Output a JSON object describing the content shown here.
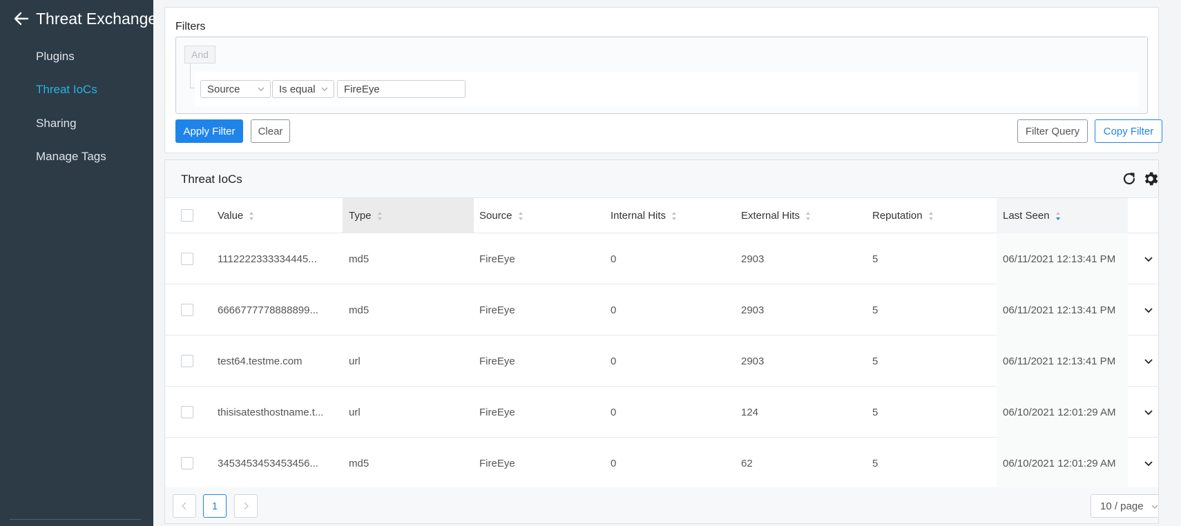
{
  "sidebar": {
    "title": "Threat Exchange",
    "items": [
      {
        "label": "Plugins",
        "active": false
      },
      {
        "label": "Threat IoCs",
        "active": true
      },
      {
        "label": "Sharing",
        "active": false
      },
      {
        "label": "Manage Tags",
        "active": false
      }
    ]
  },
  "filters": {
    "label": "Filters",
    "operator": "And",
    "condition": {
      "field": "Source",
      "comparator": "Is equal",
      "value": "FireEye"
    },
    "apply_label": "Apply Filter",
    "clear_label": "Clear",
    "query_label": "Filter Query",
    "copy_label": "Copy Filter"
  },
  "table": {
    "title": "Threat IoCs",
    "columns": [
      "Value",
      "Type",
      "Source",
      "Internal Hits",
      "External Hits",
      "Reputation",
      "Last Seen"
    ],
    "rows": [
      {
        "value": "1112222333334445...",
        "type": "md5",
        "source": "FireEye",
        "internal": "0",
        "external": "2903",
        "reputation": "5",
        "last_seen": "06/11/2021 12:13:41 PM"
      },
      {
        "value": "6666777778888899...",
        "type": "md5",
        "source": "FireEye",
        "internal": "0",
        "external": "2903",
        "reputation": "5",
        "last_seen": "06/11/2021 12:13:41 PM"
      },
      {
        "value": "test64.testme.com",
        "type": "url",
        "source": "FireEye",
        "internal": "0",
        "external": "2903",
        "reputation": "5",
        "last_seen": "06/11/2021 12:13:41 PM"
      },
      {
        "value": "thisisatesthostname.t...",
        "type": "url",
        "source": "FireEye",
        "internal": "0",
        "external": "124",
        "reputation": "5",
        "last_seen": "06/10/2021 12:01:29 AM"
      },
      {
        "value": "3453453453453456...",
        "type": "md5",
        "source": "FireEye",
        "internal": "0",
        "external": "62",
        "reputation": "5",
        "last_seen": "06/10/2021 12:01:29 AM"
      }
    ]
  },
  "pagination": {
    "current_page": "1",
    "page_size": "10 / page"
  },
  "colors": {
    "sidebar_bg": "#2d3b47",
    "accent": "#1f84ea",
    "active_nav": "#25b4e6"
  },
  "icons": [
    "back-arrow-icon",
    "refresh-icon",
    "gear-icon",
    "sort-icon",
    "chevron-down-icon",
    "chevron-left-icon",
    "chevron-right-icon"
  ]
}
